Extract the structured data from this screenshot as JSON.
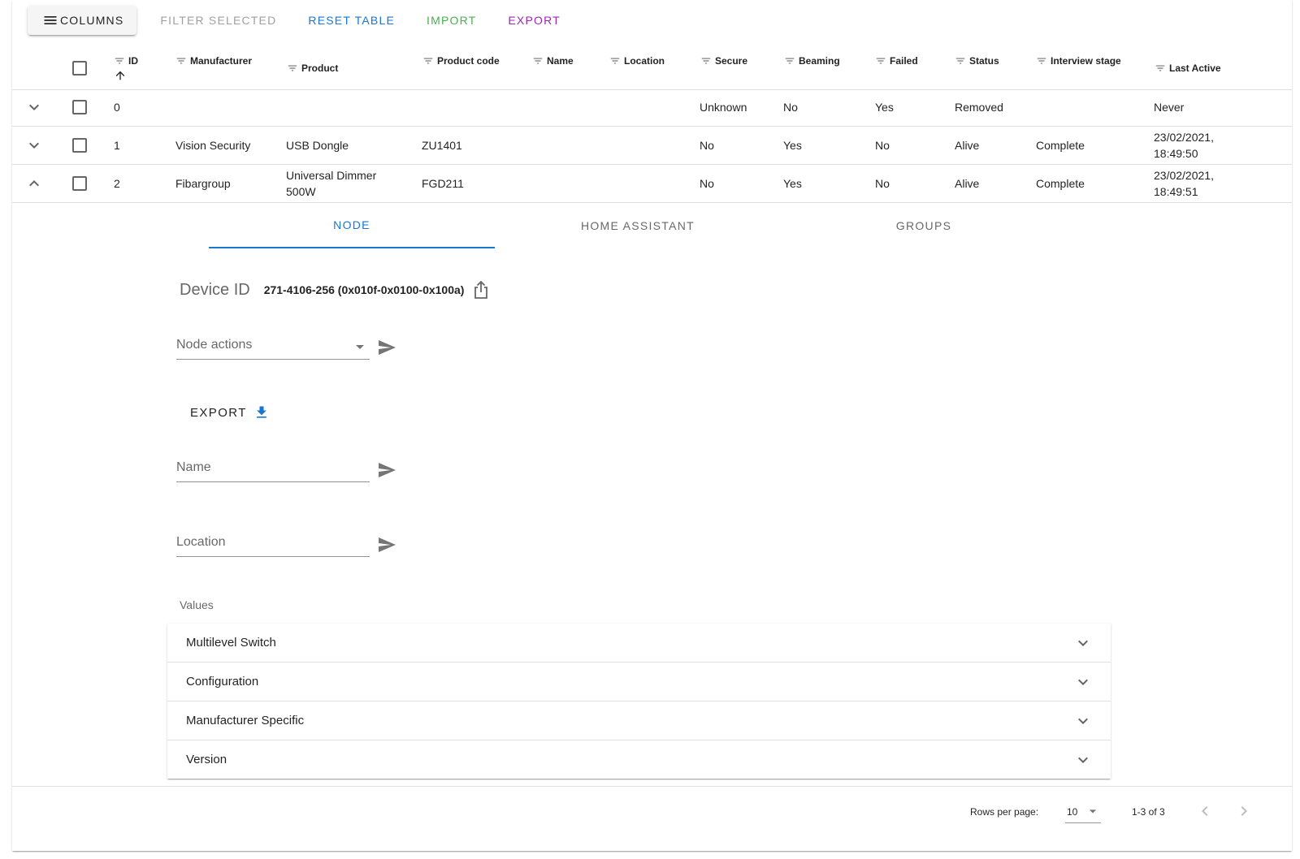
{
  "toolbar": {
    "columns": "Columns",
    "filter_selected": "Filter selected",
    "reset_table": "Reset table",
    "import": "Import",
    "export": "Export",
    "colors": {
      "reset": "#1976d2",
      "import": "#4caf50",
      "export": "#9c27b0",
      "disabled": "rgba(0,0,0,0.38)"
    }
  },
  "table": {
    "headers": {
      "id": "ID",
      "manufacturer": "Manufacturer",
      "product": "Product",
      "product_code": "Product code",
      "name": "Name",
      "location": "Location",
      "secure": "Secure",
      "beaming": "Beaming",
      "failed": "Failed",
      "status": "Status",
      "interview_stage": "Interview stage",
      "last_active": "Last Active"
    },
    "sort_icon": "arrow-up-icon",
    "rows": [
      {
        "id": "0",
        "manufacturer": "",
        "product": "",
        "product_code": "",
        "name": "",
        "location": "",
        "secure": "Unknown",
        "beaming": "No",
        "failed": "Yes",
        "status": "Removed",
        "interview_stage": "",
        "last_active_1": "Never",
        "last_active_2": ""
      },
      {
        "id": "1",
        "manufacturer": "Vision Security",
        "product": "USB Dongle",
        "product_code": "ZU1401",
        "name": "",
        "location": "",
        "secure": "No",
        "beaming": "Yes",
        "failed": "No",
        "status": "Alive",
        "interview_stage": "Complete",
        "last_active_1": "23/02/2021,",
        "last_active_2": "18:49:50"
      },
      {
        "id": "2",
        "manufacturer": "Fibargroup",
        "product_1": "Universal Dimmer",
        "product_2": "500W",
        "product_code": "FGD211",
        "name": "",
        "location": "",
        "secure": "No",
        "beaming": "Yes",
        "failed": "No",
        "status": "Alive",
        "interview_stage": "Complete",
        "last_active_1": "23/02/2021,",
        "last_active_2": "18:49:51"
      }
    ]
  },
  "detail": {
    "tabs": [
      "Node",
      "Home Assistant",
      "Groups"
    ],
    "active_tab": "Node",
    "device_id_label": "Device ID",
    "device_id_value": "271-4106-256 (0x010f-0x0100-0x100a)",
    "node_actions_placeholder": "Node actions",
    "export_label": "EXPORT",
    "name_placeholder": "Name",
    "location_placeholder": "Location",
    "values_label": "Values",
    "value_groups": [
      "Multilevel Switch",
      "Configuration",
      "Manufacturer Specific",
      "Version"
    ]
  },
  "pagination": {
    "rows_per_page_label": "Rows per page:",
    "rows_per_page_value": "10",
    "range": "1-3 of 3"
  }
}
